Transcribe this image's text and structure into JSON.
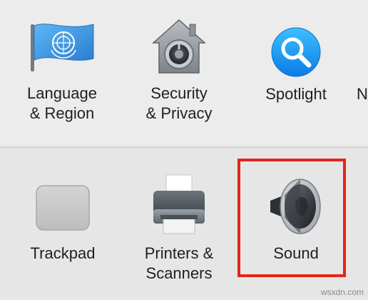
{
  "top_row": {
    "language_region": {
      "line1": "Language",
      "line2": "& Region",
      "icon": "un-flag-icon"
    },
    "security_privacy": {
      "line1": "Security",
      "line2": "& Privacy",
      "icon": "security-house-icon"
    },
    "spotlight": {
      "label": "Spotlight",
      "icon": "spotlight-magnifier-icon"
    },
    "next_partial": {
      "label": "N"
    }
  },
  "bottom_row": {
    "trackpad": {
      "label": "Trackpad",
      "icon": "trackpad-icon"
    },
    "printers_scanners": {
      "line1": "Printers &",
      "line2": "Scanners",
      "icon": "printer-icon"
    },
    "sound": {
      "label": "Sound",
      "icon": "speaker-icon",
      "highlighted": true
    }
  },
  "highlight_color": "#e52617",
  "watermark": "wsxdn.com"
}
